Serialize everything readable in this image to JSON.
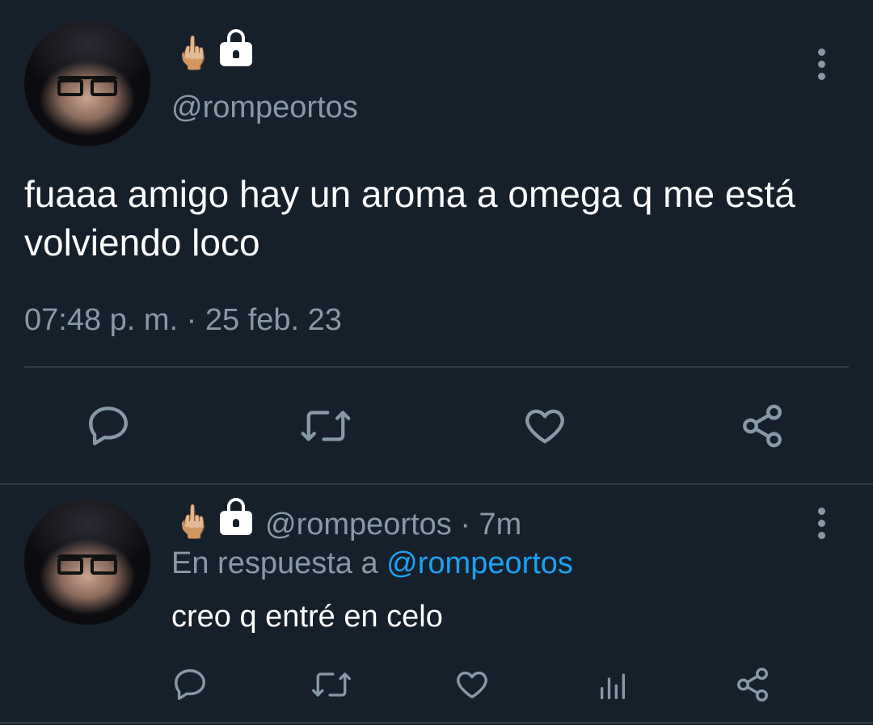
{
  "tweet": {
    "handle": "@rompeortos",
    "name_emoji": "🖕🏼",
    "text": "fuaaa amigo hay un aroma a omega q me está volviendo loco",
    "timestamp": "07:48 p. m. · 25 feb. 23",
    "icons": [
      "more-vertical-icon",
      "reply-icon",
      "retweet-icon",
      "like-icon",
      "share-icon"
    ]
  },
  "reply": {
    "handle": "@rompeortos",
    "time": "· 7m",
    "in_reply_prefix": "En respuesta a",
    "in_reply_handle": "@rompeortos",
    "name_emoji": "🖕🏼",
    "text": "creo q entré en celo",
    "icons": [
      "more-vertical-icon",
      "reply-icon",
      "retweet-icon",
      "like-icon",
      "analytics-icon",
      "share-icon"
    ]
  },
  "colors": {
    "background": "#16202b",
    "muted": "#8899a6",
    "link": "#1da1f2",
    "divider": "#2f3b46"
  }
}
